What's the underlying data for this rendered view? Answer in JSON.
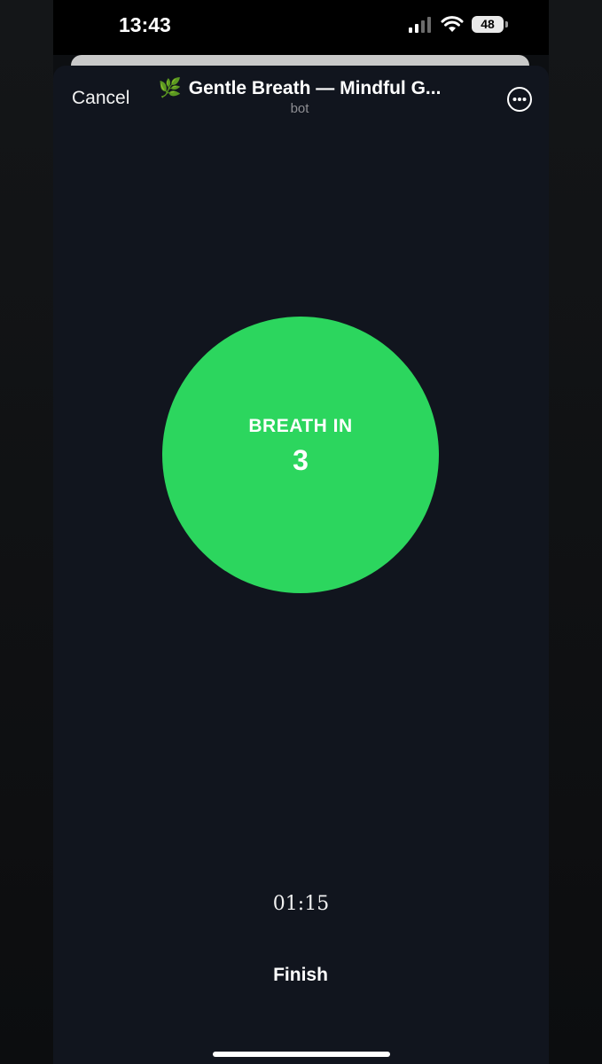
{
  "status_bar": {
    "time": "13:43",
    "battery": "48",
    "icons": [
      "signal-icon",
      "wifi-icon",
      "battery-icon"
    ]
  },
  "header": {
    "cancel_label": "Cancel",
    "title_emoji": "🌿",
    "title": "Gentle Breath — Mindful G...",
    "subtitle": "bot",
    "more_icon": "ellipsis-circle-icon"
  },
  "breathing": {
    "phase": "BREATH IN",
    "count": "3",
    "circle_color": "#2cd65e"
  },
  "timer": "01:15",
  "finish_label": "Finish",
  "colors": {
    "background": "#11151e",
    "accent": "#2cd65e"
  }
}
